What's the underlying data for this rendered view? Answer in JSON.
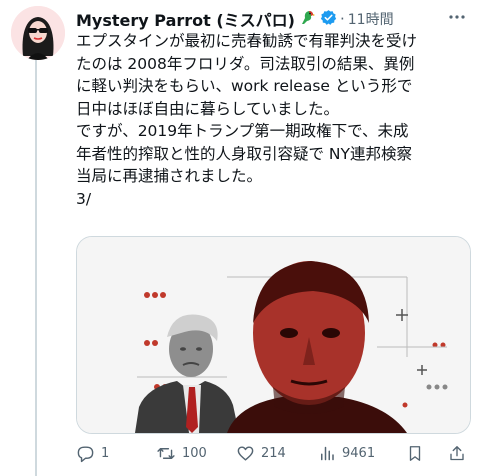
{
  "tweet": {
    "author_name": "Mystery Parrot (ミスパロ)",
    "separator": "·",
    "time": "11時間",
    "text_lines": [
      "エプスタインが最初に売春勧誘で有罪判決を受け",
      "たのは 2008年フロリダ。司法取引の結果、異例",
      "に軽い判決をもらい、work release という形で",
      "日中はほぼ自由に暮らしていました。",
      "ですが、2019年トランプ第一期政権下で、未成",
      "年者性的搾取と性的人身取引容疑で NY連邦検察",
      "当局に再逮捕されました。",
      "3/"
    ],
    "icons": {
      "avatar": "avatar-woman-sunglasses",
      "emoji": "parrot-emoji",
      "verified": "verified-badge-icon",
      "more": "more-icon"
    }
  },
  "media": {
    "kind": "image",
    "description_icon": "collage-photo"
  },
  "actions": {
    "reply": {
      "icon": "reply-icon",
      "count": "1"
    },
    "retweet": {
      "icon": "retweet-icon",
      "count": "100"
    },
    "like": {
      "icon": "heart-icon",
      "count": "214"
    },
    "views": {
      "icon": "views-icon",
      "count": "9461"
    },
    "bookmark": {
      "icon": "bookmark-icon"
    },
    "share": {
      "icon": "share-icon"
    }
  },
  "colors": {
    "accent": "#1d9bf0",
    "muted": "#536471",
    "border": "#cfd9de",
    "media_red": "#c0392b"
  }
}
